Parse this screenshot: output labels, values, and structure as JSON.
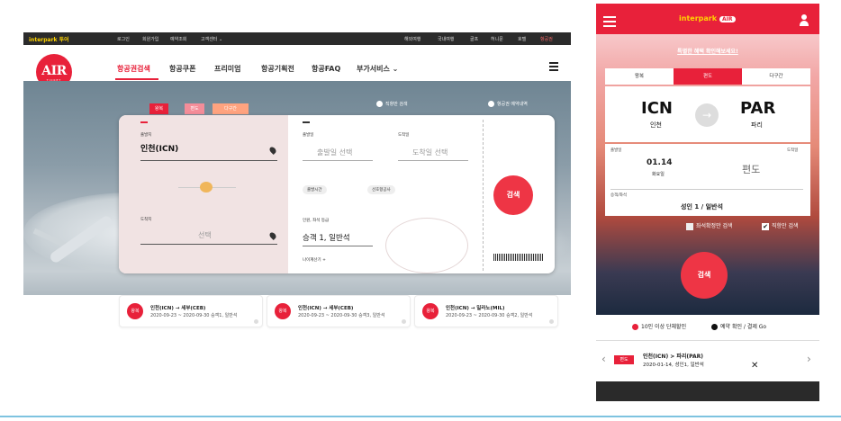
{
  "desktop": {
    "topbar": {
      "logo": "interpark 투어",
      "left_links": [
        "로그인",
        "회원가입",
        "예약조회",
        "고객센터 ⌄"
      ],
      "right_links": [
        "해외여행",
        "국내여행",
        "골프",
        "허니문",
        "호텔",
        "항공권"
      ]
    },
    "brand": {
      "logo_text": "AIR",
      "logo_sub": "TICKET"
    },
    "nav": [
      "항공권검색",
      "항공쿠폰",
      "프리미엄",
      "항공기획전",
      "항공FAQ",
      "부가서비스 ⌄"
    ],
    "search": {
      "tabs": [
        "왕복",
        "편도",
        "다구간"
      ],
      "options": {
        "direct": "직항만 검색",
        "reserve": "항공권 예약내역"
      },
      "depart_label": "출발지",
      "depart_value": "인천(ICN)",
      "arrive_label": "도착지",
      "arrive_value": "선택",
      "depart_date_label": "출발일",
      "depart_date_ph": "출발일 선택",
      "arrive_date_label": "도착일",
      "arrive_date_ph": "도착일 선택",
      "depart_time": "출발시간",
      "airline": "선호항공사",
      "pax_label": "인원, 좌석 등급",
      "pax_value": "승객 1, 일반석",
      "age_calc": "나이계산기 +",
      "search_btn": "검색"
    },
    "recent": [
      {
        "badge": "왕복",
        "route": "인천(ICN) → 세부(CEB)",
        "detail": "2020-09-23 ~ 2020-09-30 승객1, 일반석"
      },
      {
        "badge": "왕복",
        "route": "인천(ICN) → 세부(CEB)",
        "detail": "2020-09-23 ~ 2020-09-30 승객3, 일반석"
      },
      {
        "badge": "왕복",
        "route": "인천(ICN) → 밀라노(MIL)",
        "detail": "2020-09-23 ~ 2020-09-30 승객2, 일반석"
      }
    ]
  },
  "mobile": {
    "logo": "interpark",
    "logo_badge": "AIR",
    "promo": "특별한 혜택 확인해보세요!",
    "tabs": [
      "왕복",
      "편도",
      "다구간"
    ],
    "from_code": "ICN",
    "from_city": "인천",
    "to_code": "PAR",
    "to_city": "파리",
    "depart_label": "출발일",
    "arrive_label": "도착일",
    "depart_date": "01.14",
    "depart_day": "화요일",
    "arrive_value": "편도",
    "pax_label": "승객/좌석",
    "pax_value": "성인 1 / 일반석",
    "check1": "좌석확정만 검색",
    "check2": "직항만 검색",
    "search_btn": "검색",
    "info1": "10인 이상 단체할인",
    "info2": "예약 확인 / 결제 Go",
    "recent_badge": "편도",
    "recent_route": "인천(ICN) > 파리(PAR)",
    "recent_detail": "2020-01-14, 성인1, 일반석"
  }
}
